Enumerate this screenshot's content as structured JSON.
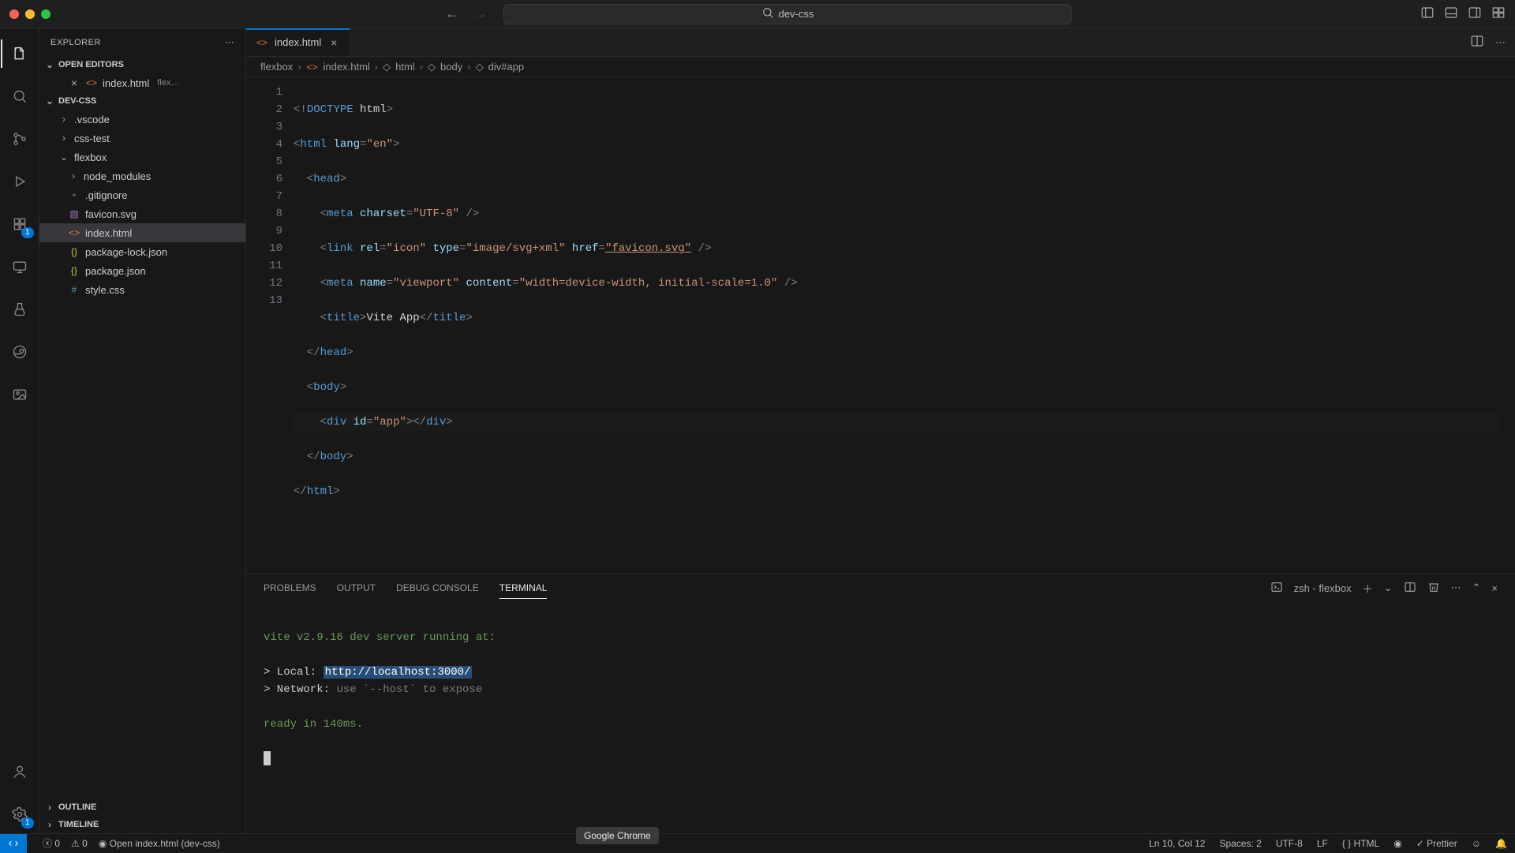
{
  "titlebar": {
    "search": "dev-css"
  },
  "sidebar": {
    "title": "EXPLORER",
    "open_editors_label": "OPEN EDITORS",
    "open_editors": [
      {
        "name": "index.html",
        "dir": "flex…"
      }
    ],
    "workspace_label": "DEV-CSS",
    "tree": {
      "vscode": ".vscode",
      "csstest": "css-test",
      "flexbox": "flexbox",
      "flex_children": {
        "node_modules": "node_modules",
        "gitignore": ".gitignore",
        "favicon": "favicon.svg",
        "index": "index.html",
        "pkglock": "package-lock.json",
        "pkg": "package.json",
        "style": "style.css"
      }
    },
    "outline_label": "OUTLINE",
    "timeline_label": "TIMELINE"
  },
  "tabs": {
    "active": "index.html"
  },
  "breadcrumbs": {
    "p0": "flexbox",
    "p1": "index.html",
    "p2": "html",
    "p3": "body",
    "p4": "div#app"
  },
  "code": {
    "l1": {
      "a": "<!",
      "b": "DOCTYPE",
      "c": " html",
      "d": ">"
    },
    "l2": {
      "a": "<",
      "b": "html",
      "c": " lang",
      "d": "=",
      "e": "\"en\"",
      "f": ">"
    },
    "l3": {
      "a": "  <",
      "b": "head",
      "c": ">"
    },
    "l4": {
      "a": "    <",
      "b": "meta",
      "c": " charset",
      "d": "=",
      "e": "\"UTF-8\"",
      "f": " />"
    },
    "l5": {
      "a": "    <",
      "b": "link",
      "c": " rel",
      "d": "=",
      "e": "\"icon\"",
      "f": " type",
      "g": "=",
      "h": "\"image/svg+xml\"",
      "i": " href",
      "j": "=",
      "k": "\"favicon.svg\"",
      "l": " />"
    },
    "l6": {
      "a": "    <",
      "b": "meta",
      "c": " name",
      "d": "=",
      "e": "\"viewport\"",
      "f": " content",
      "g": "=",
      "h": "\"width=device-width, initial-scale=1.0\"",
      "i": " />"
    },
    "l7": {
      "a": "    <",
      "b": "title",
      "c": ">",
      "d": "Vite App",
      "e": "</",
      "f": "title",
      "g": ">"
    },
    "l8": {
      "a": "  </",
      "b": "head",
      "c": ">"
    },
    "l9": {
      "a": "  <",
      "b": "body",
      "c": ">"
    },
    "l10": {
      "a": "    <",
      "b": "div",
      "c": " id",
      "d": "=",
      "e": "\"app\"",
      "f": ">",
      "g": "</",
      "h": "div",
      "i": ">"
    },
    "l11": {
      "a": "  </",
      "b": "body",
      "c": ">"
    },
    "l12": {
      "a": "</",
      "b": "html",
      "c": ">"
    }
  },
  "line_numbers": [
    "1",
    "2",
    "3",
    "4",
    "5",
    "6",
    "7",
    "8",
    "9",
    "10",
    "11",
    "12",
    "13"
  ],
  "panel": {
    "problems": "PROBLEMS",
    "output": "OUTPUT",
    "debug": "DEBUG CONSOLE",
    "terminal": "TERMINAL",
    "shell_label": "zsh - flexbox"
  },
  "terminal": {
    "l1": "vite v2.9.16 dev server running at:",
    "l2a": "> Local:   ",
    "l2b": "http://localhost:3000/",
    "l3a": "> Network: ",
    "l3b": "use `--host` to expose",
    "l4": "ready in 140ms."
  },
  "statusbar": {
    "errors": "0",
    "warnings": "0",
    "open_html": "Open index.html (dev-css)",
    "lncol": "Ln 10, Col 12",
    "spaces": "Spaces: 2",
    "encoding": "UTF-8",
    "eol": "LF",
    "lang": "HTML",
    "prettier": "Prettier"
  },
  "tooltip": "Google Chrome",
  "activity_badges": {
    "ext": "1",
    "settings": "1"
  }
}
